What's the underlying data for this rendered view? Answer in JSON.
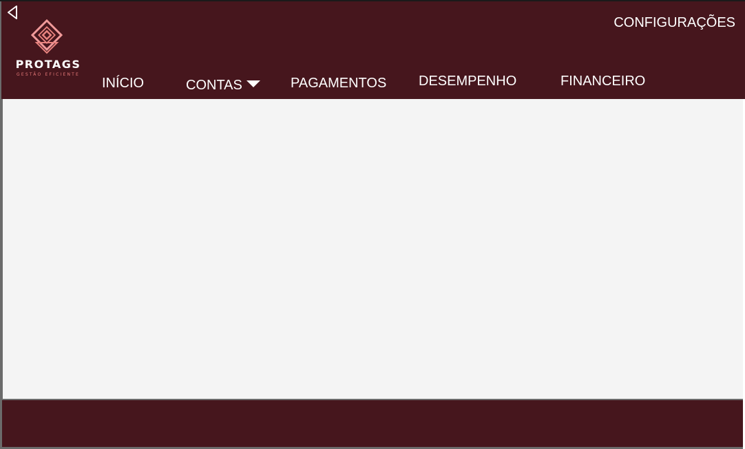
{
  "header": {
    "logo": {
      "name": "PROTAGS",
      "tagline": "GESTÃO EFICIENTE",
      "icon": "diamond-logo-icon"
    },
    "back_icon": "triangle-left-icon",
    "settings_label": "CONFIGURAÇÕES",
    "nav": {
      "inicio": "INÍCIO",
      "contas": "CONTAS",
      "pagamentos": "PAGAMENTOS",
      "desempenho": "DESEMPENHO",
      "financeiro": "FINANCEIRO"
    }
  },
  "colors": {
    "header_bg": "#46161d",
    "footer_bg": "#46161d",
    "content_bg": "#f4f4f4",
    "logo_accent": "#e87a7a",
    "text": "#ffffff"
  }
}
